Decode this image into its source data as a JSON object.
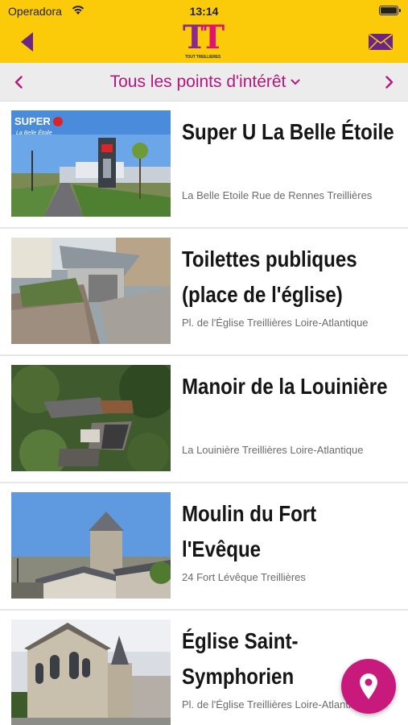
{
  "status_bar": {
    "carrier": "Operadora",
    "time": "13:14"
  },
  "header": {
    "logo_letters": "TT",
    "logo_caption": "TOUT TREILLIÈRES",
    "back_icon": "back-arrow-icon",
    "mail_icon": "envelope-icon",
    "colors": {
      "background": "#fbcb0a",
      "icon": "#6b2585"
    }
  },
  "filter": {
    "label": "Tous les points d'intérêt",
    "prev_icon": "chevron-left-icon",
    "next_icon": "chevron-right-icon",
    "dropdown_icon": "chevron-down-icon",
    "color": "#b5167f"
  },
  "items": [
    {
      "title": "Super U La Belle Étoile",
      "address": "La Belle Etoile Rue de Rennes Treillières",
      "image": "supermarket-photo",
      "thumb_text": "SUPER",
      "thumb_sub": "La Belle Étoile"
    },
    {
      "title": "Toilettes publiques (place de l'église)",
      "address": "Pl. de l'Église Treillières Loire-Atlantique",
      "image": "public-toilets-photo"
    },
    {
      "title": "Manoir de la Louinière",
      "address": "La Louinière Treillières Loire-Atlantique",
      "image": "manor-aerial-photo"
    },
    {
      "title": "Moulin du Fort l'Evêque",
      "address": "24 Fort Lévêque Treillières",
      "image": "windmill-tower-photo"
    },
    {
      "title": "Église Saint-Symphorien",
      "address": "Pl. de l'Église Treillières Loire-Atlantique",
      "image": "church-photo"
    }
  ],
  "fab": {
    "icon": "map-pin-icon",
    "color": "#c8197d"
  }
}
